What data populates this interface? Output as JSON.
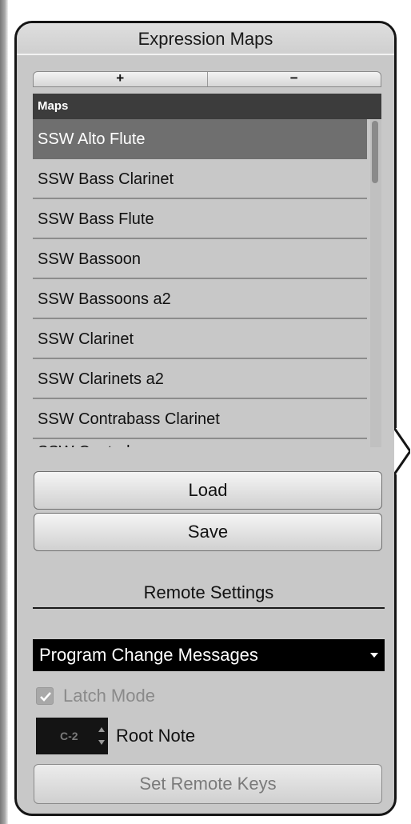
{
  "panel": {
    "title": "Expression Maps"
  },
  "toolbar": {
    "add_label": "+",
    "remove_label": "−"
  },
  "maps": {
    "header": "Maps",
    "items": [
      "SSW Alto Flute",
      "SSW Bass Clarinet",
      "SSW Bass Flute",
      "SSW Bassoon",
      "SSW Bassoons a2",
      "SSW Clarinet",
      "SSW Clarinets a2",
      "SSW Contrabass Clarinet",
      "SSW Contrab..."
    ],
    "selected": "SSW Alto Flute"
  },
  "actions": {
    "load_label": "Load",
    "save_label": "Save"
  },
  "remote": {
    "title": "Remote Settings",
    "mode_selected": "Program Change Messages",
    "latch_label": "Latch Mode",
    "latch_checked": true,
    "root_note_value": "C-2",
    "root_note_label": "Root Note",
    "set_keys_label": "Set Remote Keys"
  },
  "colors": {
    "panel_bg": "#c8c8c8",
    "header_bg": "#3c3c3c",
    "selected_bg": "#6f6f6f",
    "dropdown_bg": "#000000"
  }
}
